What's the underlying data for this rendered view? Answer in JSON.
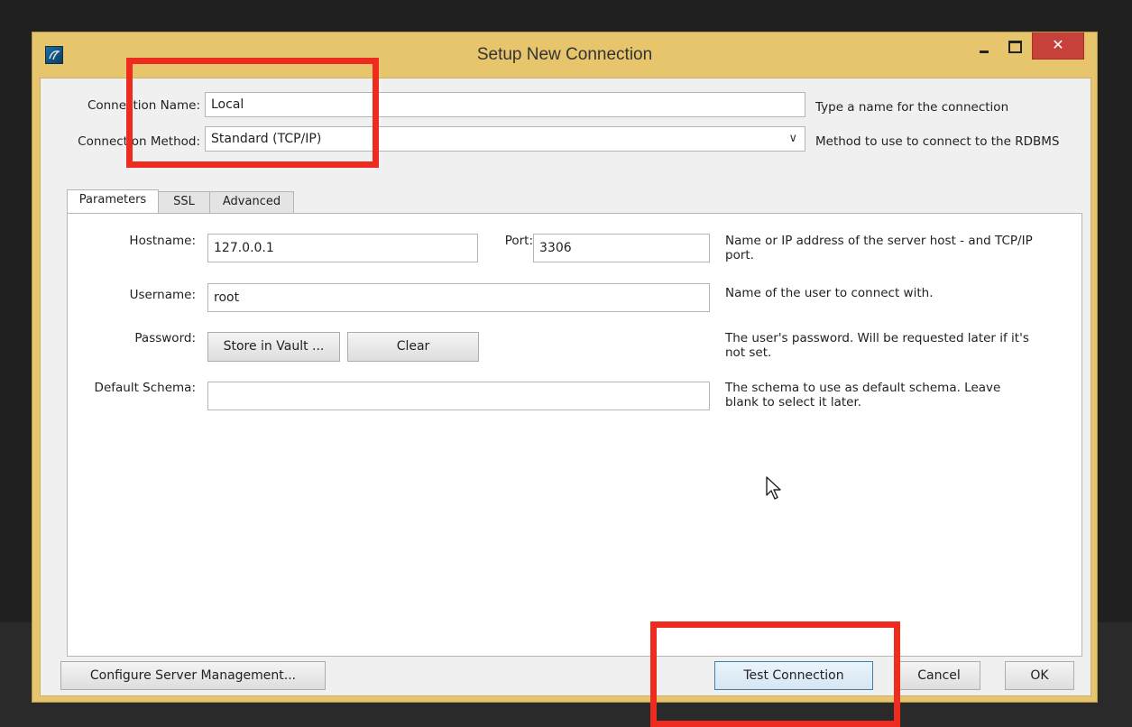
{
  "window": {
    "title": "Setup New Connection",
    "close_glyph": "✕"
  },
  "connection": {
    "name_label": "Connection Name:",
    "name_value": "Local",
    "name_hint": "Type a name for the connection",
    "method_label": "Connection Method:",
    "method_value": "Standard (TCP/IP)",
    "method_hint": "Method to use to connect to the RDBMS"
  },
  "tabs": [
    {
      "label": "Parameters",
      "active": true
    },
    {
      "label": "SSL",
      "active": false
    },
    {
      "label": "Advanced",
      "active": false
    }
  ],
  "parameters": {
    "hostname_label": "Hostname:",
    "hostname_value": "127.0.0.1",
    "port_label": "Port:",
    "port_value": "3306",
    "hostname_hint": "Name or IP address of the server host - and TCP/IP port.",
    "username_label": "Username:",
    "username_value": "root",
    "username_hint": "Name of the user to connect with.",
    "password_label": "Password:",
    "store_vault_label": "Store in Vault ...",
    "clear_label": "Clear",
    "password_hint": "The user's password. Will be requested later if it's not set.",
    "schema_label": "Default Schema:",
    "schema_value": "",
    "schema_hint": "The schema to use as default schema. Leave blank to select it later."
  },
  "footer": {
    "configure_label": "Configure Server Management...",
    "test_label": "Test Connection",
    "cancel_label": "Cancel",
    "ok_label": "OK"
  },
  "colors": {
    "highlight": "#ee2b1f",
    "window_frame": "#e7c56d",
    "close_button": "#c7413a"
  }
}
